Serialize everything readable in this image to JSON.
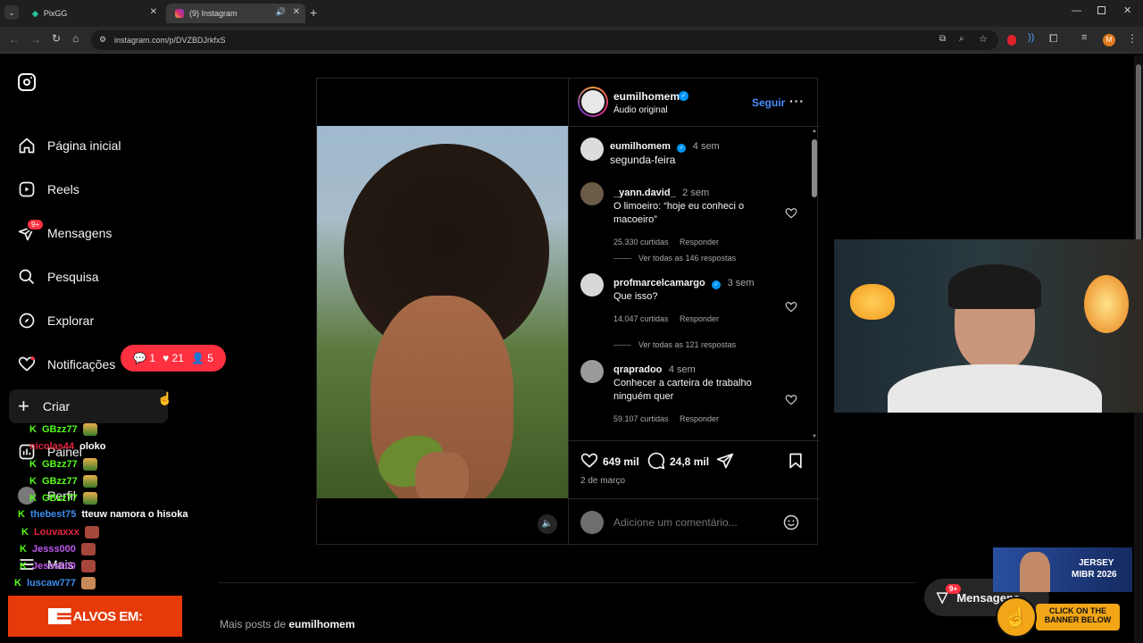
{
  "browser": {
    "tabs": [
      {
        "title": "PixGG"
      },
      {
        "title": "(9) Instagram"
      }
    ],
    "new_tab": "+",
    "url": "instagram.com/p/DVZBDJrkfxS",
    "profile_initial": "M"
  },
  "sidebar": {
    "items": [
      {
        "label": "Página inicial"
      },
      {
        "label": "Reels"
      },
      {
        "label": "Mensagens",
        "badge": "9+"
      },
      {
        "label": "Pesquisa"
      },
      {
        "label": "Explorar"
      },
      {
        "label": "Notificações"
      },
      {
        "label": "Criar"
      },
      {
        "label": "Painel"
      },
      {
        "label": "Perfil"
      },
      {
        "label": "Mais"
      }
    ],
    "notif_popup": {
      "comments": "1",
      "likes": "21",
      "follows": "5"
    }
  },
  "post": {
    "author": "eumilhomem",
    "audio": "Áudio original",
    "follow_label": "Seguir",
    "caption": {
      "user": "eumilhomem",
      "time": "4 sem",
      "text": "segunda-feira"
    },
    "comments": [
      {
        "user": "_yann.david_",
        "time": "2 sem",
        "text": "O limoeiro: “hoje eu conheci o macoeiro”",
        "likes": "25.330 curtidas",
        "reply": "Responder",
        "replies": "Ver todas as 146 respostas"
      },
      {
        "user": "profmarcelcamargo",
        "time": "3 sem",
        "text": "Que isso?",
        "likes": "14.047 curtidas",
        "reply": "Responder",
        "replies": "Ver todas as 121 respostas"
      },
      {
        "user": "qrapradoo",
        "time": "4 sem",
        "text": "Conhecer a carteira de trabalho ninguém quer",
        "likes": "59.107 curtidas",
        "reply": "Responder"
      }
    ],
    "like_count": "649 mil",
    "comment_count": "24,8 mil",
    "date": "2 de março",
    "comment_placeholder": "Adicione um comentário..."
  },
  "more_posts": {
    "prefix": "Mais posts de ",
    "user": "eumilhomem"
  },
  "messages_fab": {
    "label": "Mensagens",
    "badge": "9+"
  },
  "chat": [
    {
      "user": "GBzz77",
      "color": "#53fc18",
      "msg": ""
    },
    {
      "user": "nicolas44",
      "color": "#e6243f",
      "msg": "oloko"
    },
    {
      "user": "GBzz77",
      "color": "#53fc18",
      "msg": ""
    },
    {
      "user": "GBzz77",
      "color": "#53fc18",
      "msg": ""
    },
    {
      "user": "GBzz77",
      "color": "#53fc18",
      "msg": ""
    },
    {
      "user": "thebest75",
      "color": "#3b8ded",
      "msg": "tteuw namora o hisoka"
    },
    {
      "user": "Louvaxxx",
      "color": "#e6243f",
      "msg": ""
    },
    {
      "user": "Jesss000",
      "color": "#c058f0",
      "msg": ""
    },
    {
      "user": "Jesss000",
      "color": "#c058f0",
      "msg": ""
    },
    {
      "user": "luscaw777",
      "color": "#3b8ded",
      "msg": ""
    }
  ],
  "stream_banner": {
    "text": "ALVOS EM:"
  },
  "ad": {
    "line1": "JERSEY",
    "line2": "MIBR 2026",
    "cta1": "CLICK ON THE",
    "cta2": "BANNER BELOW"
  }
}
